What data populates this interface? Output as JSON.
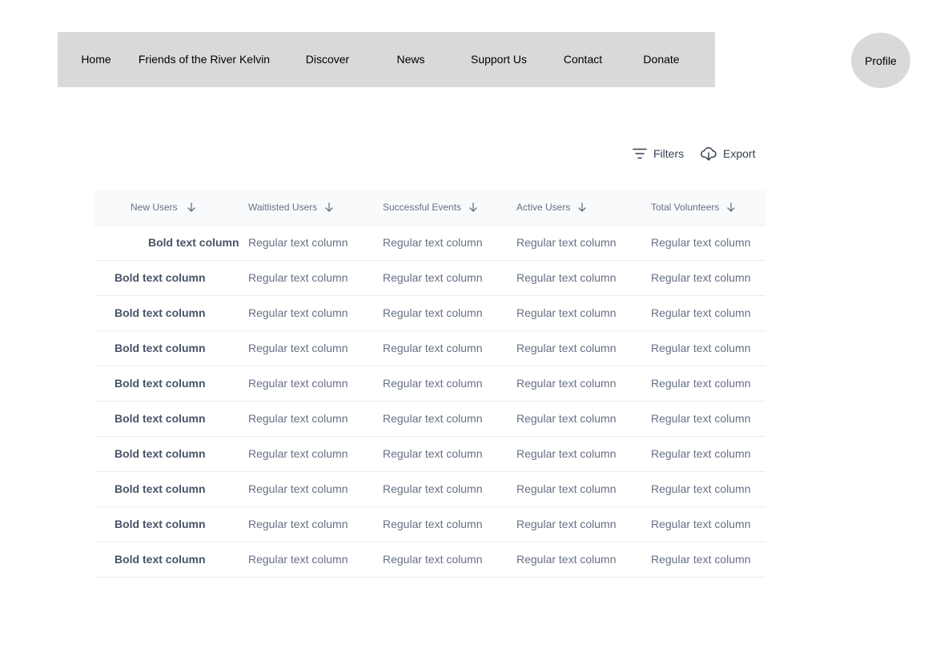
{
  "nav": {
    "items": [
      {
        "label": "Home"
      },
      {
        "label": "Friends of the River Kelvin"
      },
      {
        "label": "Discover"
      },
      {
        "label": "News"
      },
      {
        "label": "Support Us"
      },
      {
        "label": "Contact"
      },
      {
        "label": "Donate"
      }
    ],
    "profile_label": "Profile"
  },
  "toolbar": {
    "filters_label": "Filters",
    "export_label": "Export",
    "filters_icon": "filter-lines-icon",
    "export_icon": "cloud-download-icon"
  },
  "table": {
    "columns": [
      {
        "label": "New Users",
        "sort_icon": "arrow-down-icon"
      },
      {
        "label": "Waitlisted Users",
        "sort_icon": "arrow-down-icon"
      },
      {
        "label": "Successful Events",
        "sort_icon": "arrow-down-icon"
      },
      {
        "label": "Active Users",
        "sort_icon": "arrow-down-icon"
      },
      {
        "label": "Total Volunteers",
        "sort_icon": "arrow-down-icon"
      }
    ],
    "rows": [
      [
        "Bold text column",
        "Regular text column",
        "Regular text column",
        "Regular text column",
        "Regular text column"
      ],
      [
        "Bold text column",
        "Regular text column",
        "Regular text column",
        "Regular text column",
        "Regular text column"
      ],
      [
        "Bold text column",
        "Regular text column",
        "Regular text column",
        "Regular text column",
        "Regular text column"
      ],
      [
        "Bold text column",
        "Regular text column",
        "Regular text column",
        "Regular text column",
        "Regular text column"
      ],
      [
        "Bold text column",
        "Regular text column",
        "Regular text column",
        "Regular text column",
        "Regular text column"
      ],
      [
        "Bold text column",
        "Regular text column",
        "Regular text column",
        "Regular text column",
        "Regular text column"
      ],
      [
        "Bold text column",
        "Regular text column",
        "Regular text column",
        "Regular text column",
        "Regular text column"
      ],
      [
        "Bold text column",
        "Regular text column",
        "Regular text column",
        "Regular text column",
        "Regular text column"
      ],
      [
        "Bold text column",
        "Regular text column",
        "Regular text column",
        "Regular text column",
        "Regular text column"
      ],
      [
        "Bold text column",
        "Regular text column",
        "Regular text column",
        "Regular text column",
        "Regular text column"
      ]
    ]
  },
  "colors": {
    "nav_bg": "#d9d9d9",
    "header_bg": "#f9fafb",
    "border": "#eaecf0",
    "text_muted": "#667085",
    "text_bold": "#475467"
  }
}
